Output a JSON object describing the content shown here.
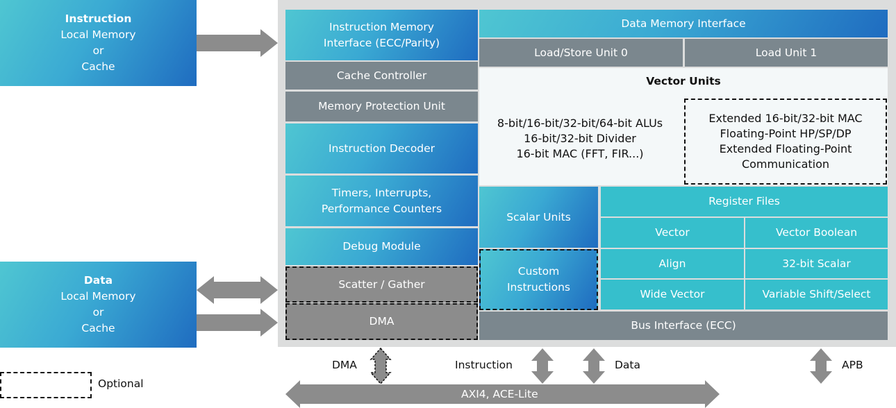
{
  "external": {
    "instruction": {
      "title": "Instruction",
      "line1": "Local Memory",
      "line2": "or",
      "line3": "Cache"
    },
    "data": {
      "title": "Data",
      "line1": "Local Memory",
      "line2": "or",
      "line3": "Cache"
    },
    "legend_optional": "Optional"
  },
  "left_column": {
    "imi_line1": "Instruction Memory",
    "imi_line2": "Interface (ECC/Parity)",
    "cache_controller": "Cache Controller",
    "mpu": "Memory Protection Unit",
    "decoder": "Instruction Decoder",
    "timers_line1": "Timers, Interrupts,",
    "timers_line2": "Performance Counters",
    "debug": "Debug Module",
    "scatter": "Scatter / Gather",
    "dma": "DMA"
  },
  "right_column": {
    "dmi": "Data Memory Interface",
    "lsu0": "Load/Store Unit 0",
    "lu1": "Load Unit 1",
    "vector": {
      "title": "Vector Units",
      "std": [
        "8-bit/16-bit/32-bit/64-bit ALUs",
        "16-bit/32-bit Divider",
        "16-bit MAC (FFT, FIR...)"
      ],
      "optional": [
        "Extended 16-bit/32-bit MAC",
        "Floating-Point HP/SP/DP",
        "Extended Floating-Point",
        "Communication"
      ]
    },
    "scalar": "Scalar Units",
    "custom_line1": "Custom",
    "custom_line2": "Instructions",
    "register_files": {
      "title": "Register Files",
      "cells": [
        "Vector",
        "Vector Boolean",
        "Align",
        "32-bit Scalar",
        "Wide Vector",
        "Variable Shift/Select"
      ]
    },
    "bus": "Bus Interface (ECC)"
  },
  "bus_labels": {
    "dma": "DMA",
    "instruction": "Instruction",
    "data": "Data",
    "apb": "APB",
    "axi": "AXI4, ACE-Lite"
  },
  "colors": {
    "gradient_start": "#4fc6d2",
    "gradient_end": "#1f6cc0",
    "gray": "#7b878e",
    "teal": "#36bfcc",
    "arrow": "#8c8c8c"
  }
}
